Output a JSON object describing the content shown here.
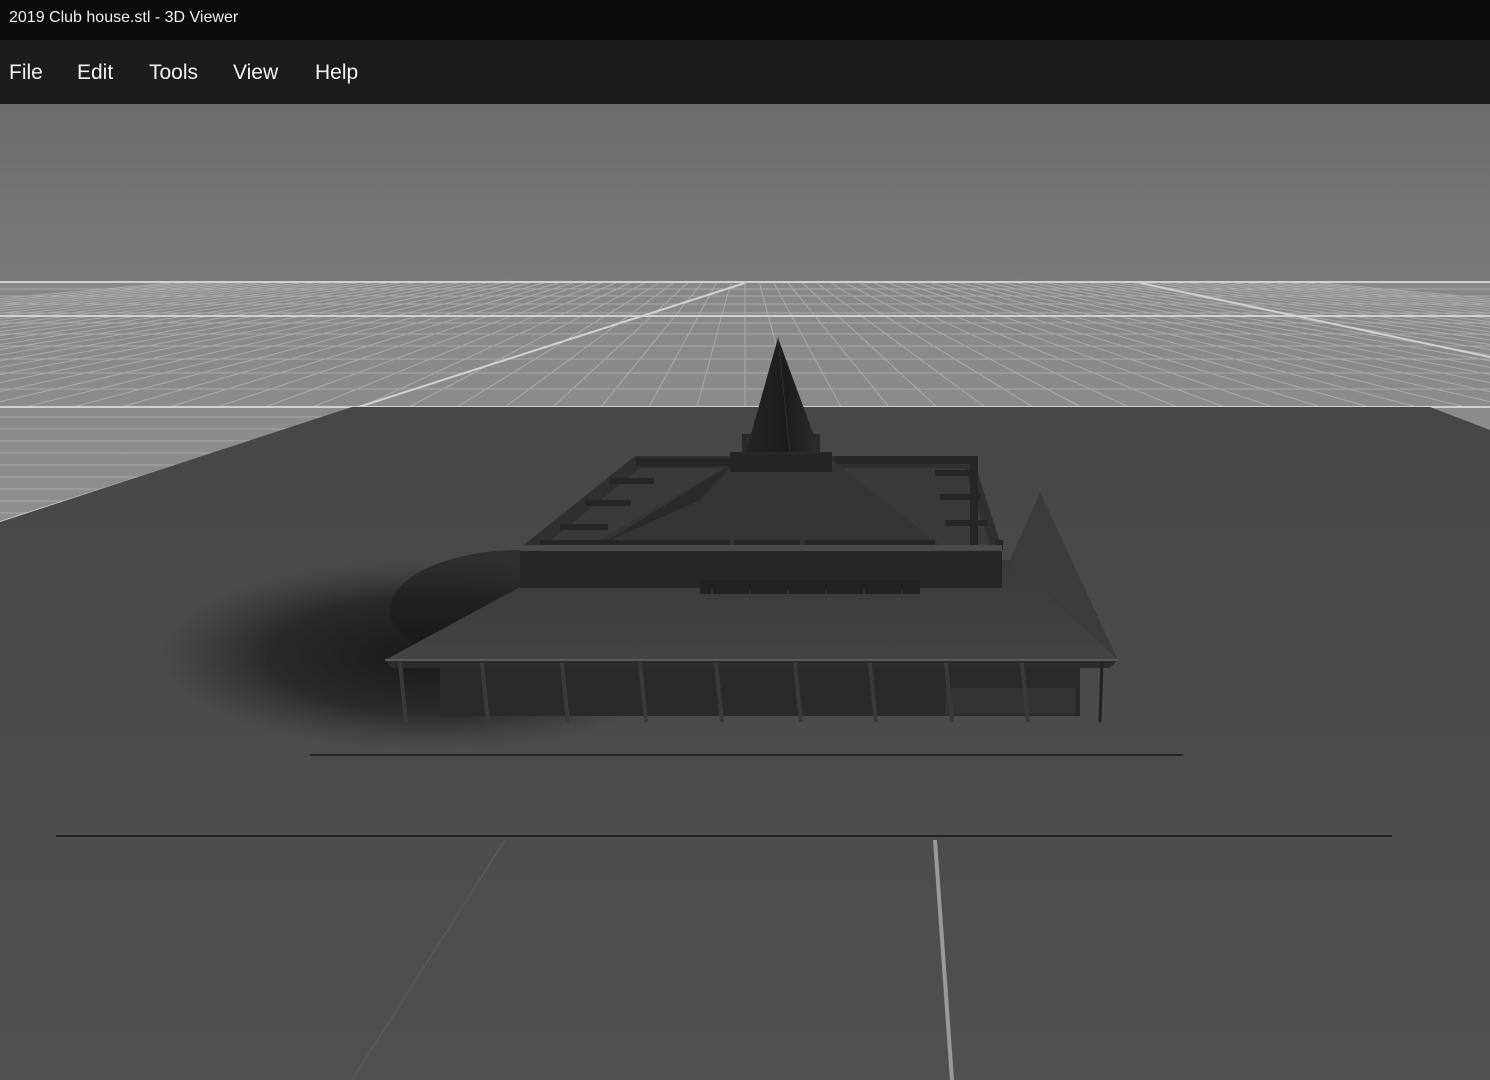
{
  "window": {
    "title": "2019 Club house.stl - 3D Viewer"
  },
  "menu": {
    "items": [
      {
        "label": "File"
      },
      {
        "label": "Edit"
      },
      {
        "label": "Tools"
      },
      {
        "label": "View"
      },
      {
        "label": "Help"
      }
    ]
  },
  "viewport": {
    "model_name": "2019 Club house.stl",
    "colors": {
      "sky_top": "#6e6e6e",
      "sky_bottom": "#7a7a7a",
      "grid_plane": "#8c8c8c",
      "grid_line": "#b4b4b4",
      "ground": "#4a4a4a",
      "model": "#2a2a2a",
      "shadow": "#1a1a1a"
    }
  }
}
